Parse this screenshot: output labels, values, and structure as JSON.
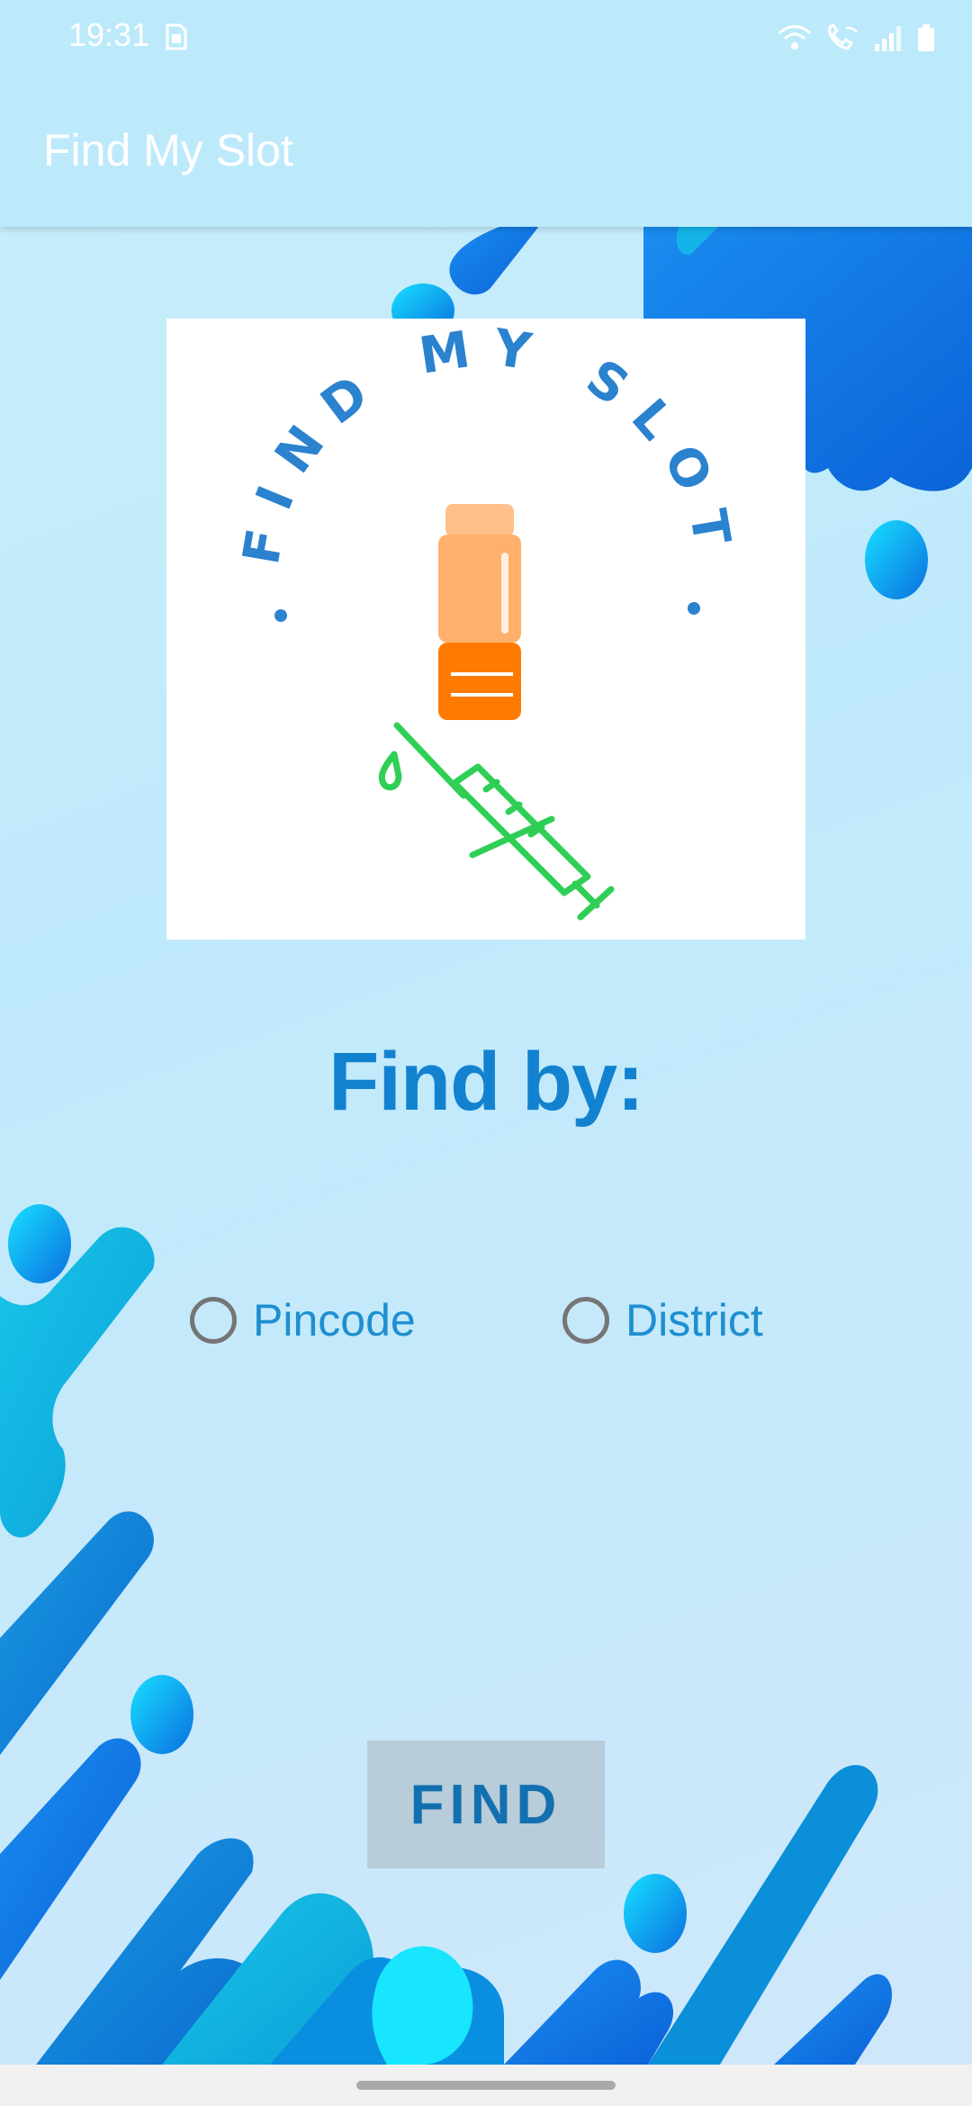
{
  "status_bar": {
    "time": "19:31",
    "icons": [
      "sim-card-icon",
      "wifi-icon",
      "wifi-calling-icon",
      "signal-icon",
      "battery-icon"
    ]
  },
  "app_bar": {
    "title": "Find My Slot"
  },
  "logo": {
    "text": "FIND MY SLOT",
    "colors": {
      "text": "#2b82cf",
      "vial": "#ffb16b",
      "vial_dark": "#ff7a00",
      "syringe": "#2fcf55"
    }
  },
  "main": {
    "heading": "Find by:",
    "options": [
      {
        "label": "Pincode",
        "selected": false
      },
      {
        "label": "District",
        "selected": false
      }
    ],
    "find_button": "FIND"
  },
  "theme": {
    "accent": "#1282d0",
    "background": "#c2ebfb"
  }
}
